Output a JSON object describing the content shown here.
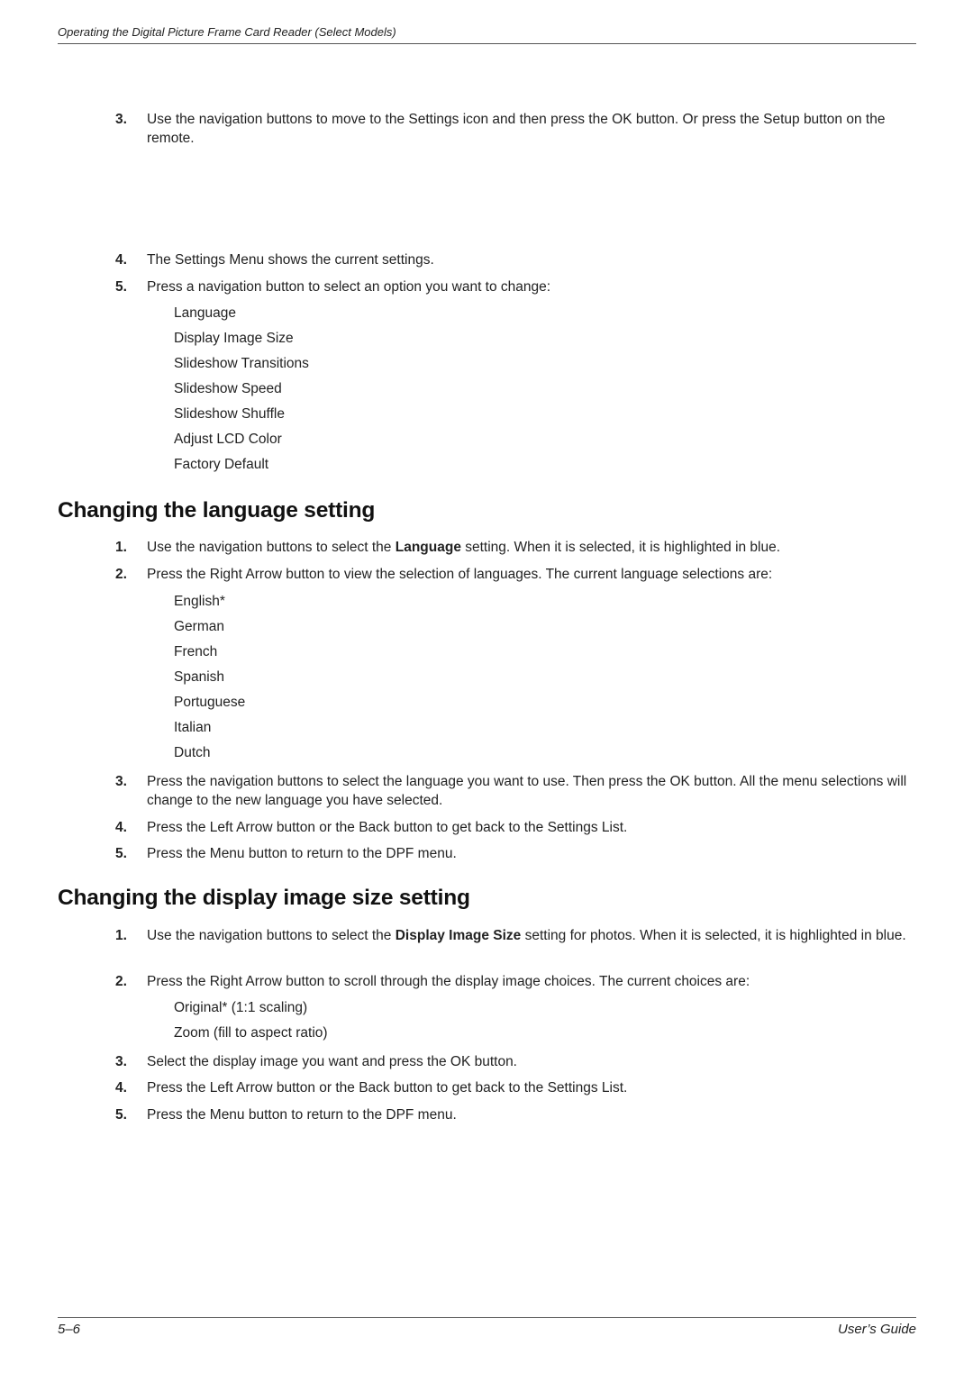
{
  "header": {
    "running_title": "Operating the Digital Picture Frame Card Reader (Select Models)"
  },
  "intro_steps": [
    {
      "num": "3.",
      "text": "Use the navigation buttons to move to the Settings icon and then press the OK button. Or press the Setup button on the remote."
    },
    {
      "num": "4.",
      "text": "The Settings Menu shows the current settings."
    },
    {
      "num": "5.",
      "text": "Press a navigation button to select an option you want to change:"
    }
  ],
  "settings_options": [
    "Language",
    "Display Image Size",
    "Slideshow Transitions",
    "Slideshow Speed",
    "Slideshow Shuffle",
    "Adjust LCD Color",
    "Factory Default"
  ],
  "language_section": {
    "heading": "Changing the language setting",
    "step1": {
      "num": "1.",
      "pre": "Use the navigation buttons to select the ",
      "bold": "Language",
      "post": " setting. When it is selected, it is highlighted in blue."
    },
    "step2": {
      "num": "2.",
      "text": "Press the Right Arrow button to view the selection of languages. The current language selections are:"
    },
    "languages": [
      "English*",
      "German",
      "French",
      "Spanish",
      "Portuguese",
      "Italian",
      "Dutch"
    ],
    "step3": {
      "num": "3.",
      "text": "Press the navigation buttons to select the language you want to use. Then press the OK button. All the menu selections will change to the new language you have selected."
    },
    "step4": {
      "num": "4.",
      "text": "Press the Left Arrow button or the Back button to get back to the Settings List."
    },
    "step5": {
      "num": "5.",
      "text": "Press the Menu button to return to the DPF menu."
    }
  },
  "display_section": {
    "heading": "Changing the display image size setting",
    "step1": {
      "num": "1.",
      "pre": "Use the navigation buttons to select the ",
      "bold": "Display Image Size",
      "post": " setting for photos. When it is selected, it is highlighted in blue."
    },
    "step2": {
      "num": "2.",
      "text": "Press the Right Arrow button to scroll through the display image choices. The current choices are:"
    },
    "choices": [
      "Original* (1:1 scaling)",
      "Zoom (fill to aspect ratio)"
    ],
    "step3": {
      "num": "3.",
      "text": "Select the display image you want and press the OK button."
    },
    "step4": {
      "num": "4.",
      "text": "Press the Left Arrow button or the Back button to get back to the Settings List."
    },
    "step5": {
      "num": "5.",
      "text": "Press the Menu button to return to the DPF menu."
    }
  },
  "footer": {
    "page_number": "5–6",
    "guide_title": "User’s Guide"
  }
}
